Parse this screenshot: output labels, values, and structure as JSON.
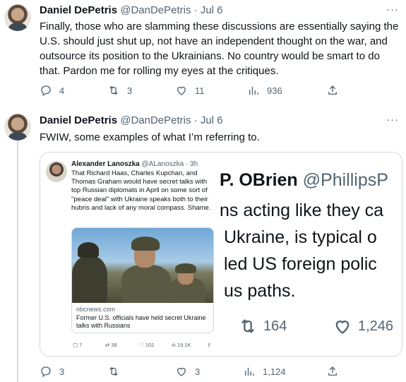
{
  "tweet1": {
    "name": "Daniel DePetris",
    "handle": "@DanDePetris",
    "dot": "·",
    "time": "Jul 6",
    "more": "···",
    "text": "Finally, those who are slamming these discussions are essentially saying the U.S. should just shut up, not have an independent thought on the war, and outsource its position to the Ukrainians. No country would be smart to do that. Pardon me for rolling my eyes at the critiques.",
    "replies": "4",
    "retweets": "3",
    "likes": "11",
    "views": "936"
  },
  "tweet2": {
    "name": "Daniel DePetris",
    "handle": "@DanDePetris",
    "dot": "·",
    "time": "Jul 6",
    "more": "···",
    "text": "FWIW, some examples of what I’m referring to.",
    "replies": "3",
    "retweets": "",
    "likes": "3",
    "views": "1,124"
  },
  "quoted_left": {
    "name": "Alexander Lanoszka",
    "handle": "@ALanoszka · 3h",
    "text": "That Richard Haas, Charles Kupchan, and Thomas Graham would have secret talks with top Russian diplomats in April on some sort of \"peace deal\" with Ukraine speaks both to their hubris and lack of any moral compass. Shame.",
    "link_domain": "nbcnews.com",
    "link_title": "Former U.S. officials have held secret Ukraine talks with Russians",
    "replies": "7",
    "retweets": "38",
    "likes": "102",
    "views": "19.1K"
  },
  "quoted_right": {
    "line1_name": "P. OBrien",
    "line1_handle": "@PhillipsP",
    "line2": "ns acting like they ca",
    "line3": "Ukraine, is typical o",
    "line4": "led US foreign polic",
    "line5": "us paths.",
    "retweets": "164",
    "likes": "1,246"
  },
  "icons": {
    "reply": "reply-icon",
    "retweet": "retweet-icon",
    "like": "heart-icon",
    "views": "views-icon",
    "share": "share-icon"
  }
}
